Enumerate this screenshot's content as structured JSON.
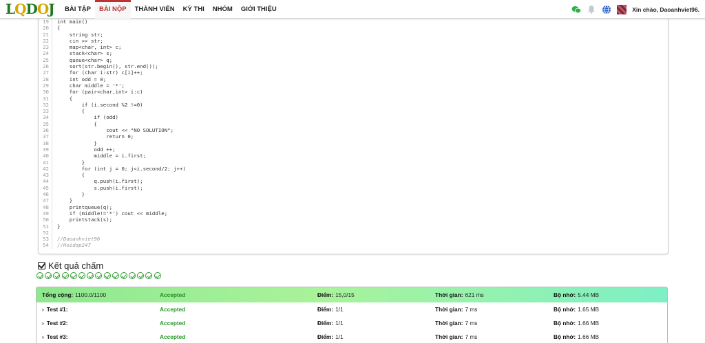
{
  "nav": {
    "logo": [
      "L",
      "Q",
      "D",
      "O",
      "J"
    ],
    "items": [
      {
        "label": "BÀI TẬP",
        "active": false
      },
      {
        "label": "BÀI NỘP",
        "active": true
      },
      {
        "label": "THÀNH VIÊN",
        "active": false
      },
      {
        "label": "KỲ THI",
        "active": false
      },
      {
        "label": "NHÓM",
        "active": false
      },
      {
        "label": "GIỚI THIỆU",
        "active": false
      }
    ],
    "greeting": "Xin chào, Daoanhviet96."
  },
  "code": {
    "lines": [
      {
        "n": "19",
        "text": "int main()"
      },
      {
        "n": "20",
        "text": "{"
      },
      {
        "n": "21",
        "text": "    string str;"
      },
      {
        "n": "22",
        "text": "    cin >> str;"
      },
      {
        "n": "23",
        "text": "    map<char, int> c;"
      },
      {
        "n": "24",
        "text": "    stack<char> s;"
      },
      {
        "n": "25",
        "text": "    queue<char> q;"
      },
      {
        "n": "26",
        "text": "    sort(str.begin(), str.end());"
      },
      {
        "n": "27",
        "text": "    for (char i:str) c[i]++;"
      },
      {
        "n": "28",
        "text": "    int odd = 0;"
      },
      {
        "n": "29",
        "text": "    char middle = '*';"
      },
      {
        "n": "30",
        "text": "    for (pair<char,int> i:c)"
      },
      {
        "n": "31",
        "text": "    {"
      },
      {
        "n": "32",
        "text": "        if (i.second %2 !=0)"
      },
      {
        "n": "33",
        "text": "        {"
      },
      {
        "n": "34",
        "text": "            if (odd)"
      },
      {
        "n": "35",
        "text": "            {"
      },
      {
        "n": "36",
        "text": "                cout << \"NO SOLUTION\";"
      },
      {
        "n": "37",
        "text": "                return 0;"
      },
      {
        "n": "38",
        "text": "            }"
      },
      {
        "n": "39",
        "text": "            odd ++;"
      },
      {
        "n": "40",
        "text": "            middle = i.first;"
      },
      {
        "n": "41",
        "text": "        }"
      },
      {
        "n": "42",
        "text": "        for (int j = 0; j<i.second/2; j++)"
      },
      {
        "n": "43",
        "text": "        {"
      },
      {
        "n": "44",
        "text": "            q.push(i.first);"
      },
      {
        "n": "45",
        "text": "            s.push(i.first);"
      },
      {
        "n": "46",
        "text": "        }"
      },
      {
        "n": "47",
        "text": "    }"
      },
      {
        "n": "48",
        "text": "    printqueue(q);"
      },
      {
        "n": "49",
        "text": "    if (middle!='*') cout << middle;"
      },
      {
        "n": "50",
        "text": "    printstack(s);"
      },
      {
        "n": "51",
        "text": "}"
      },
      {
        "n": "52",
        "text": ""
      },
      {
        "n": "53",
        "text": "//Daoanhviet96",
        "comment": true
      },
      {
        "n": "54",
        "text": "//Hoidap247",
        "comment": true
      }
    ]
  },
  "results": {
    "title": "Kết quả chấm",
    "test_count": 15,
    "labels": {
      "score": "Điểm:",
      "time": "Thời gian:",
      "memory": "Bộ nhớ:"
    },
    "total": {
      "label": "Tổng cộng:",
      "value": "1100.0/1100",
      "status": "Accepted",
      "score": "15,0/15",
      "time": "621 ms",
      "memory": "5.44 MB"
    },
    "tests": [
      {
        "label": "Test #1:",
        "status": "Accepted",
        "score": "1/1",
        "time": "7 ms",
        "memory": "1.65 MB"
      },
      {
        "label": "Test #2:",
        "status": "Accepted",
        "score": "1/1",
        "time": "7 ms",
        "memory": "1.66 MB"
      },
      {
        "label": "Test #3:",
        "status": "Accepted",
        "score": "1/1",
        "time": "7 ms",
        "memory": "1.66 MB"
      }
    ]
  },
  "colors": {
    "accepted": "#2a9a2a",
    "active_nav": "#b33333",
    "total_row": "#8ee88e"
  }
}
